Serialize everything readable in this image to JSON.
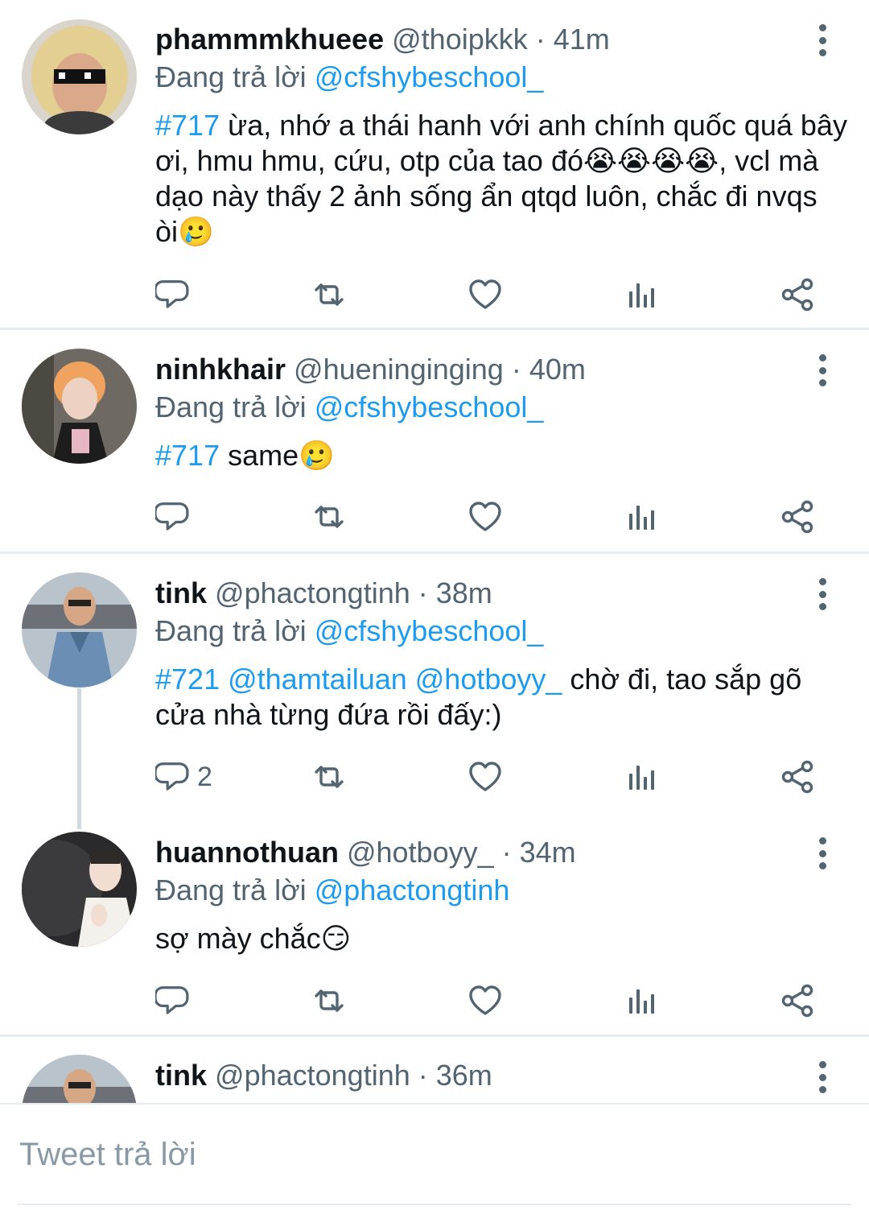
{
  "tweets": [
    {
      "display_name": "phammmkhueee",
      "handle": "@thoipkkk",
      "time": "· 41m",
      "replying_label": "Đang trả lời",
      "replying_to": "@cfshybeschool_",
      "hashtag": "#717",
      "text": " ừa, nhớ a thái hanh với anh chính quốc quá bây ơi, hmu hmu, cứu, otp của tao đó😭😭😭😭, vcl mà dạo này thấy 2 ảnh sống ẩn qtqd luôn, chắc đi nvqs òi🥲",
      "reply_count": ""
    },
    {
      "display_name": "ninhkhair",
      "handle": "@hueninginging",
      "time": "· 40m",
      "replying_label": "Đang trả lời",
      "replying_to": "@cfshybeschool_",
      "hashtag": "#717",
      "text": " same🥲",
      "reply_count": ""
    },
    {
      "display_name": "tink",
      "handle": "@phactongtinh",
      "time": "· 38m",
      "replying_label": "Đang trả lời",
      "replying_to": "@cfshybeschool_",
      "hashtag": "#721",
      "mentions": " @thamtailuan @hotboyy_",
      "text": " chờ đi, tao sắp gõ cửa nhà từng đứa rồi đấy:)",
      "reply_count": "2"
    },
    {
      "display_name": "huannothuan",
      "handle": "@hotboyy_",
      "time": "· 34m",
      "replying_label": "Đang trả lời",
      "replying_to": "@phactongtinh",
      "text": "sợ mày chắc😏",
      "reply_count": ""
    },
    {
      "display_name": "tink",
      "handle": "@phactongtinh",
      "time": "· 36m"
    }
  ],
  "compose": {
    "placeholder": "Tweet trả lời"
  },
  "icons": {
    "reply": "reply-icon",
    "retweet": "retweet-icon",
    "like": "like-icon",
    "analytics": "analytics-icon",
    "share": "share-icon",
    "more": "more-options-icon"
  },
  "colors": {
    "link_blue": "#1d9bf0",
    "secondary_text": "#536471",
    "divider": "#e6ecf0"
  }
}
